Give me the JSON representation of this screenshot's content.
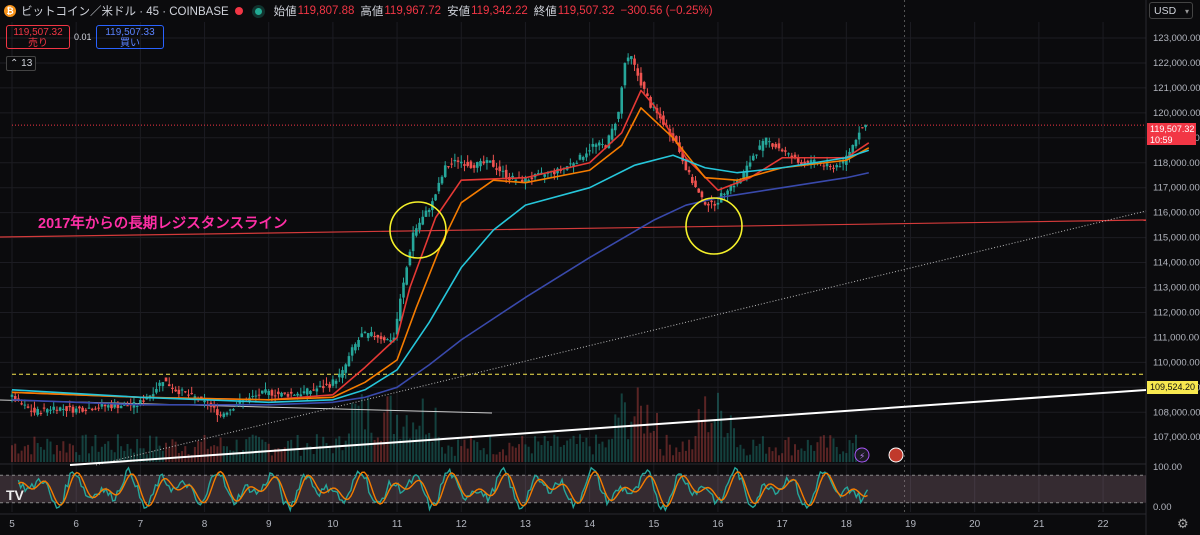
{
  "header": {
    "title": "ビットコイン／米ドル · 45 · COINBASE",
    "open_label": "始値",
    "open": "119,807.88",
    "high_label": "高値",
    "high": "119,967.72",
    "low_label": "安値",
    "low": "119,342.22",
    "close_label": "終値",
    "close": "119,507.32",
    "change": "−300.56 (−0.25%)"
  },
  "trade": {
    "sell_price": "119,507.32",
    "sell_label": "売り",
    "spread": "0.01",
    "buy_price": "119,507.33",
    "buy_label": "買い"
  },
  "indicator_toggle": "13",
  "currency": "USD",
  "annotation": "2017年からの長期レジスタンスライン",
  "price_tag": {
    "value": "119,507.32",
    "timer": "10:59"
  },
  "level_tag": "109,524.20",
  "colors": {
    "up": "#26a69a",
    "down": "#ef5350",
    "annotation": "#ff2fa6",
    "circle": "#f5f12a",
    "resistance": "#d33a3a"
  },
  "icons": {
    "coin": "bitcoin-icon",
    "settings": "gear-icon",
    "flash": "lightning-icon",
    "flag": "us-flag-icon"
  },
  "chart_data": {
    "type": "candlestick",
    "symbol": "BTCUSD",
    "interval": "45",
    "x_ticks": [
      "5",
      "6",
      "7",
      "8",
      "9",
      "10",
      "11",
      "12",
      "13",
      "14",
      "15",
      "16",
      "17",
      "18",
      "19",
      "20",
      "21",
      "22"
    ],
    "y_ticks": [
      "123,000.00",
      "122,000.00",
      "121,000.00",
      "120,000.00",
      "119,000.00",
      "118,000.00",
      "117,000.00",
      "116,000.00",
      "115,000.00",
      "114,000.00",
      "113,000.00",
      "112,000.00",
      "111,000.00",
      "110,000.00",
      "109,000.00",
      "108,000.00",
      "107,000.00"
    ],
    "ylim": [
      106600,
      123400
    ],
    "close_path": [
      [
        5.0,
        108700
      ],
      [
        5.2,
        108300
      ],
      [
        5.4,
        108000
      ],
      [
        5.7,
        108200
      ],
      [
        6.0,
        108100
      ],
      [
        6.5,
        108250
      ],
      [
        7.0,
        108300
      ],
      [
        7.2,
        108700
      ],
      [
        7.4,
        109300
      ],
      [
        7.6,
        108900
      ],
      [
        7.9,
        108600
      ],
      [
        8.1,
        108300
      ],
      [
        8.3,
        107900
      ],
      [
        8.6,
        108400
      ],
      [
        9.0,
        108800
      ],
      [
        9.3,
        108700
      ],
      [
        9.6,
        108800
      ],
      [
        10.0,
        109100
      ],
      [
        10.2,
        109600
      ],
      [
        10.35,
        110500
      ],
      [
        10.5,
        111100
      ],
      [
        10.7,
        111100
      ],
      [
        10.9,
        110900
      ],
      [
        11.0,
        111000
      ],
      [
        11.1,
        112500
      ],
      [
        11.2,
        113800
      ],
      [
        11.3,
        115200
      ],
      [
        11.45,
        115800
      ],
      [
        11.6,
        116400
      ],
      [
        11.8,
        117800
      ],
      [
        12.0,
        118100
      ],
      [
        12.2,
        117900
      ],
      [
        12.5,
        118000
      ],
      [
        12.8,
        117400
      ],
      [
        13.0,
        117300
      ],
      [
        13.3,
        117500
      ],
      [
        13.6,
        117700
      ],
      [
        13.9,
        118200
      ],
      [
        14.1,
        118700
      ],
      [
        14.3,
        118700
      ],
      [
        14.4,
        119300
      ],
      [
        14.5,
        120000
      ],
      [
        14.6,
        122000
      ],
      [
        14.7,
        122200
      ],
      [
        14.8,
        121500
      ],
      [
        14.9,
        120900
      ],
      [
        15.0,
        120300
      ],
      [
        15.2,
        119600
      ],
      [
        15.4,
        118800
      ],
      [
        15.6,
        117500
      ],
      [
        15.8,
        116500
      ],
      [
        15.95,
        116300
      ],
      [
        16.05,
        116500
      ],
      [
        16.2,
        117000
      ],
      [
        16.4,
        117300
      ],
      [
        16.6,
        118300
      ],
      [
        16.8,
        118900
      ],
      [
        17.0,
        118600
      ],
      [
        17.3,
        118000
      ],
      [
        17.6,
        118000
      ],
      [
        17.8,
        117800
      ],
      [
        18.0,
        118000
      ],
      [
        18.15,
        118700
      ],
      [
        18.25,
        119300
      ],
      [
        18.35,
        119500
      ]
    ],
    "moving_averages": [
      {
        "color": "#e53935",
        "points": [
          [
            5.0,
            108800
          ],
          [
            7.0,
            108600
          ],
          [
            9.0,
            108500
          ],
          [
            10.0,
            108700
          ],
          [
            10.5,
            109800
          ],
          [
            11.0,
            111000
          ],
          [
            11.2,
            113000
          ],
          [
            11.6,
            115800
          ],
          [
            12.0,
            117300
          ],
          [
            13.0,
            117400
          ],
          [
            14.0,
            118000
          ],
          [
            14.5,
            119200
          ],
          [
            14.8,
            120900
          ],
          [
            15.0,
            120300
          ],
          [
            15.5,
            118200
          ],
          [
            16.0,
            116900
          ],
          [
            16.5,
            117400
          ],
          [
            17.0,
            118200
          ],
          [
            18.0,
            118200
          ],
          [
            18.35,
            118800
          ]
        ]
      },
      {
        "color": "#f57c00",
        "points": [
          [
            5.0,
            108800
          ],
          [
            7.0,
            108600
          ],
          [
            9.0,
            108500
          ],
          [
            10.0,
            108600
          ],
          [
            10.5,
            109200
          ],
          [
            11.0,
            110100
          ],
          [
            11.3,
            112200
          ],
          [
            11.7,
            114800
          ],
          [
            12.0,
            116400
          ],
          [
            12.5,
            117300
          ],
          [
            13.0,
            117200
          ],
          [
            14.0,
            117700
          ],
          [
            14.5,
            118700
          ],
          [
            14.8,
            120200
          ],
          [
            15.3,
            119000
          ],
          [
            15.8,
            117400
          ],
          [
            16.3,
            117300
          ],
          [
            17.0,
            117800
          ],
          [
            18.0,
            118100
          ],
          [
            18.35,
            118600
          ]
        ]
      },
      {
        "color": "#26c6da",
        "points": [
          [
            5.0,
            108900
          ],
          [
            7.0,
            108600
          ],
          [
            9.0,
            108400
          ],
          [
            10.0,
            108500
          ],
          [
            10.5,
            108900
          ],
          [
            11.0,
            109700
          ],
          [
            11.5,
            111600
          ],
          [
            12.0,
            113800
          ],
          [
            12.5,
            115300
          ],
          [
            13.0,
            116300
          ],
          [
            14.0,
            117000
          ],
          [
            14.7,
            117900
          ],
          [
            15.3,
            118300
          ],
          [
            15.8,
            117800
          ],
          [
            16.3,
            117600
          ],
          [
            17.0,
            117800
          ],
          [
            18.0,
            118200
          ],
          [
            18.35,
            118500
          ]
        ]
      },
      {
        "color": "#3949ab",
        "points": [
          [
            5.0,
            108500
          ],
          [
            7.0,
            108300
          ],
          [
            9.0,
            108300
          ],
          [
            10.0,
            108400
          ],
          [
            10.5,
            108600
          ],
          [
            11.0,
            109000
          ],
          [
            11.5,
            109900
          ],
          [
            12.0,
            110900
          ],
          [
            13.0,
            112600
          ],
          [
            14.0,
            114200
          ],
          [
            15.0,
            115700
          ],
          [
            15.5,
            116300
          ],
          [
            16.0,
            116600
          ],
          [
            17.0,
            117000
          ],
          [
            18.0,
            117400
          ],
          [
            18.35,
            117600
          ]
        ]
      }
    ],
    "oscillator": {
      "ylim": [
        0,
        100
      ],
      "ticks": [
        "100.00",
        "0.00"
      ],
      "band": [
        20,
        80
      ]
    }
  }
}
